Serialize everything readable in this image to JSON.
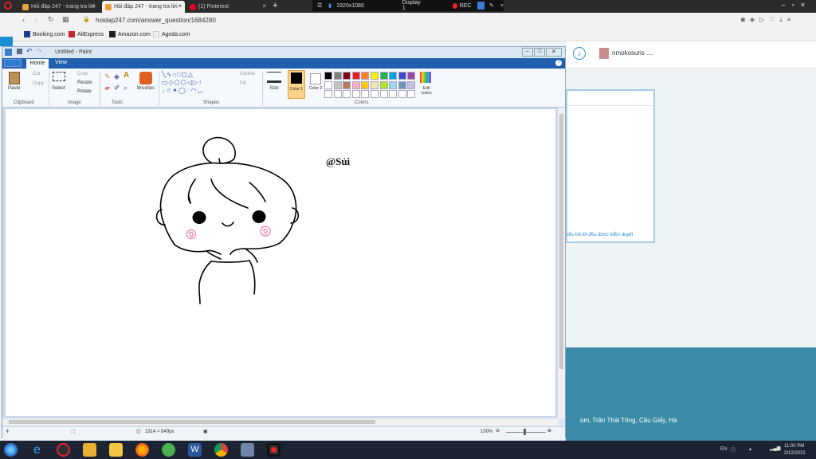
{
  "browser": {
    "tabs": [
      {
        "label": "Hỏi đáp 247 - trang tra lời",
        "active": false
      },
      {
        "label": "Hỏi đáp 247 - trang tra lời",
        "active": true
      },
      {
        "label": "(1) Pinterest",
        "active": false
      }
    ],
    "recorder": {
      "resolution": "1920x1080",
      "display": "Display 1",
      "rec": "REC"
    },
    "url": "hoidap247.com/answer_question/1684280",
    "bookmarks": [
      "Booking.com",
      "AliExpress",
      "Amazon.com",
      "Agoda.com"
    ]
  },
  "paint": {
    "title": "Untitled - Paint",
    "tabs": {
      "home": "Home",
      "view": "View"
    },
    "ribbon": {
      "paste": "Paste",
      "cut": "Cut",
      "copy": "Copy",
      "select": "Select",
      "crop": "Crop",
      "resize": "Resize",
      "rotate": "Rotate",
      "brushes": "Brushes",
      "outline": "Outline",
      "fill": "Fill",
      "size": "Size",
      "color1": "Color 1",
      "color2": "Color 2",
      "edit_colors": "Edit colors",
      "groups": {
        "clipboard": "Clipboard",
        "image": "Image",
        "tools": "Tools",
        "shapes": "Shapes",
        "colors": "Colors"
      }
    },
    "palette": [
      "#000000",
      "#7f7f7f",
      "#880015",
      "#ed1c24",
      "#ff7f27",
      "#fff200",
      "#22b14c",
      "#00a2e8",
      "#3f48cc",
      "#a349a4",
      "#ffffff",
      "#c3c3c3",
      "#b97a57",
      "#ffaec9",
      "#ffc90e",
      "#efe4b0",
      "#b5e61d",
      "#99d9ea",
      "#7092be",
      "#c8bfe7"
    ],
    "canvas_text": "@Sủi",
    "status": {
      "dimensions": "1914 × 849px",
      "zoom": "100%"
    }
  },
  "site": {
    "username": "nmokosuris ....",
    "card_note": "iểu trả lời đều được kiểm duyệt",
    "footer_address": "om, Trần Thái Tông, Cầu Giấy, Hà"
  },
  "taskbar": {
    "time": "11:00 PM",
    "date": "3/12/2021"
  }
}
